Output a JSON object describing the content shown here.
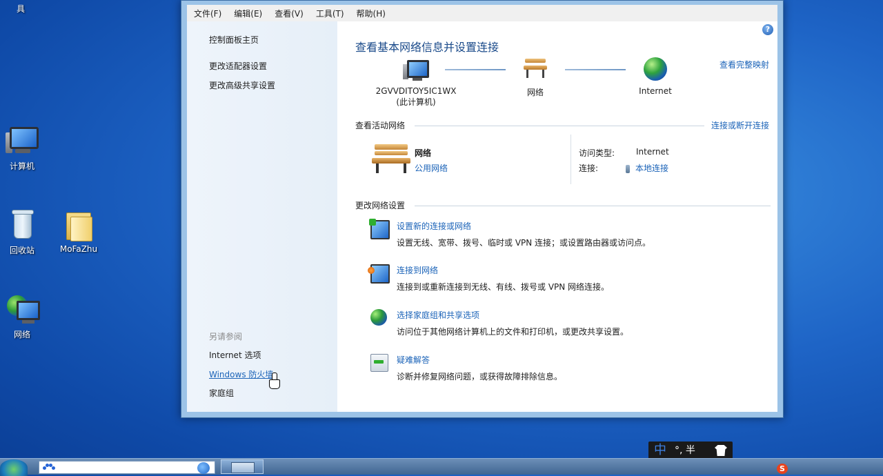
{
  "desktop": {
    "top_label": "具",
    "icons": [
      {
        "label": "计算机"
      },
      {
        "label": "回收站"
      },
      {
        "label": "MoFaZhu"
      },
      {
        "label": "网络"
      }
    ]
  },
  "menubar": {
    "items": [
      "文件(F)",
      "编辑(E)",
      "查看(V)",
      "工具(T)",
      "帮助(H)"
    ]
  },
  "left_pane": {
    "home": "控制面板主页",
    "adapter": "更改适配器设置",
    "advanced_sharing": "更改高级共享设置",
    "see_also": "另请参阅",
    "internet_options": "Internet 选项",
    "firewall": "Windows 防火墙",
    "homegroup": "家庭组"
  },
  "main": {
    "help_icon": "?",
    "title": "查看基本网络信息并设置连接",
    "view_full_map": "查看完整映射",
    "map": {
      "computer_name": "2GVVDITOY5IC1WX",
      "computer_sub": "(此计算机)",
      "network": "网络",
      "internet": "Internet"
    },
    "active": {
      "heading": "查看活动网络",
      "connect_link": "连接或断开连接",
      "network_name": "网络",
      "network_type": "公用网络",
      "access_label": "访问类型:",
      "access_value": "Internet",
      "conn_label": "连接:",
      "conn_value": "本地连接"
    },
    "change": {
      "heading": "更改网络设置",
      "tasks": [
        {
          "title": "设置新的连接或网络",
          "desc": "设置无线、宽带、拨号、临时或 VPN 连接；或设置路由器或访问点。"
        },
        {
          "title": "连接到网络",
          "desc": "连接到或重新连接到无线、有线、拨号或 VPN 网络连接。"
        },
        {
          "title": "选择家庭组和共享选项",
          "desc": "访问位于其他网络计算机上的文件和打印机，或更改共享设置。"
        },
        {
          "title": "疑难解答",
          "desc": "诊断并修复网络问题，或获得故障排除信息。"
        }
      ]
    }
  },
  "taskbar": {
    "ime_cn": "中",
    "ime_rest": "°, 半",
    "tray_sogou": "S"
  }
}
